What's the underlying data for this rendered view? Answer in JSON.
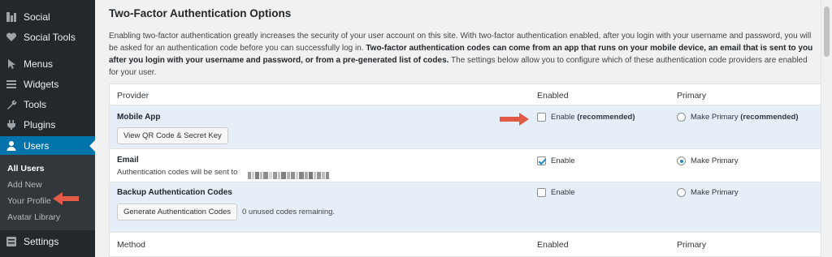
{
  "sidebar": {
    "items": [
      {
        "label": "Social",
        "icon": "social-icon"
      },
      {
        "label": "Social Tools",
        "icon": "heart-icon"
      },
      {
        "label": "Menus",
        "icon": "cursor-icon"
      },
      {
        "label": "Widgets",
        "icon": "list-icon"
      },
      {
        "label": "Tools",
        "icon": "wrench-icon"
      },
      {
        "label": "Plugins",
        "icon": "plug-icon"
      },
      {
        "label": "Users",
        "icon": "user-icon"
      },
      {
        "label": "Settings",
        "icon": "sliders-icon"
      }
    ],
    "submenu": [
      "All Users",
      "Add New",
      "Your Profile",
      "Avatar Library"
    ]
  },
  "main": {
    "title": "Two-Factor Authentication Options",
    "desc_plain": "Enabling two-factor authentication greatly increases the security of your user account on this site. With two-factor authentication enabled, after you login with your username and password, you will be asked for an authentication code before you can successfully log in.",
    "desc_bold": "Two-factor authentication codes can come from an app that runs on your mobile device, an email that is sent to you after you login with your username and password, or from a pre-generated list of codes.",
    "desc_end": "The settings below allow you to configure which of these authentication code providers are enabled for your user.",
    "table": {
      "headers": {
        "provider": "Provider",
        "enabled": "Enabled",
        "primary": "Primary"
      },
      "footer": {
        "method": "Method",
        "enabled": "Enabled",
        "primary": "Primary"
      },
      "rows": [
        {
          "name": "Mobile App",
          "button": "View QR Code & Secret Key",
          "enable_label": "Enable",
          "enable_suffix": "(recommended)",
          "primary_label": "Make Primary",
          "primary_suffix": "(recommended)",
          "enabled": false,
          "primary": false
        },
        {
          "name": "Email",
          "sub": "Authentication codes will be sent to",
          "enable_label": "Enable",
          "primary_label": "Make Primary",
          "enabled": true,
          "primary": true
        },
        {
          "name": "Backup Authentication Codes",
          "button": "Generate Authentication Codes",
          "extra": "0 unused codes remaining.",
          "enable_label": "Enable",
          "primary_label": "Make Primary",
          "enabled": false,
          "primary": false
        }
      ]
    }
  },
  "colors": {
    "sidebar": "#23282d",
    "active": "#0073aa",
    "highlight_row": "#e6eef8",
    "arrow": "#e35b46",
    "check": "#1e8cbe"
  }
}
